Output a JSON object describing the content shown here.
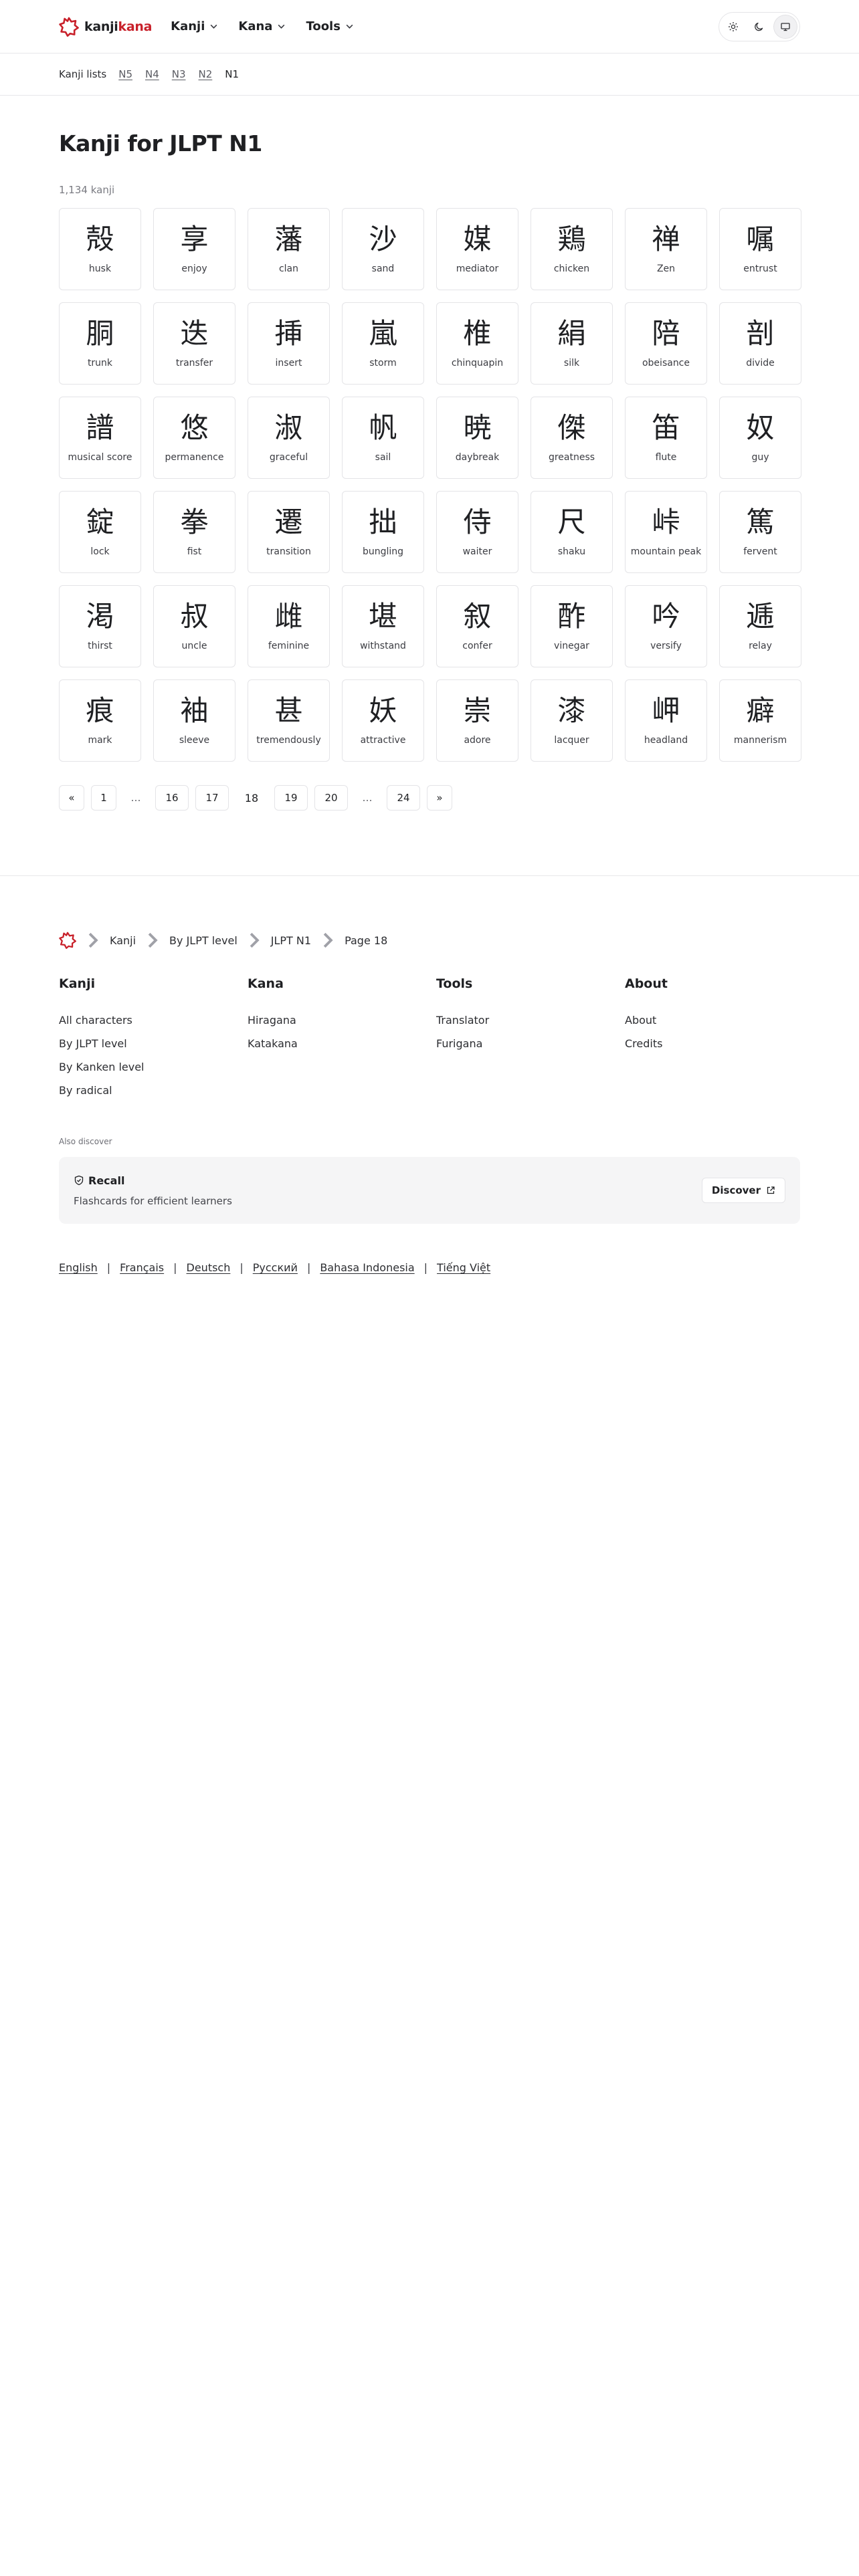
{
  "header": {
    "logo_kanji": "kanji",
    "logo_kana": "kana",
    "nav": [
      {
        "label": "Kanji"
      },
      {
        "label": "Kana"
      },
      {
        "label": "Tools"
      }
    ],
    "theme_icons": [
      "sun-icon",
      "moon-icon",
      "monitor-icon"
    ],
    "active_theme": "monitor"
  },
  "subnav": {
    "label": "Kanji lists",
    "links": [
      "N5",
      "N4",
      "N3",
      "N2"
    ],
    "current": "N1"
  },
  "main": {
    "title": "Kanji for JLPT N1",
    "count": "1,134 kanji",
    "kanji": [
      {
        "char": "殻",
        "meaning": "husk"
      },
      {
        "char": "享",
        "meaning": "enjoy"
      },
      {
        "char": "藩",
        "meaning": "clan"
      },
      {
        "char": "沙",
        "meaning": "sand"
      },
      {
        "char": "媒",
        "meaning": "mediator"
      },
      {
        "char": "鶏",
        "meaning": "chicken"
      },
      {
        "char": "禅",
        "meaning": "Zen"
      },
      {
        "char": "嘱",
        "meaning": "entrust"
      },
      {
        "char": "胴",
        "meaning": "trunk"
      },
      {
        "char": "迭",
        "meaning": "transfer"
      },
      {
        "char": "挿",
        "meaning": "insert"
      },
      {
        "char": "嵐",
        "meaning": "storm"
      },
      {
        "char": "椎",
        "meaning": "chinquapin"
      },
      {
        "char": "絹",
        "meaning": "silk"
      },
      {
        "char": "陪",
        "meaning": "obeisance"
      },
      {
        "char": "剖",
        "meaning": "divide"
      },
      {
        "char": "譜",
        "meaning": "musical score"
      },
      {
        "char": "悠",
        "meaning": "permanence"
      },
      {
        "char": "淑",
        "meaning": "graceful"
      },
      {
        "char": "帆",
        "meaning": "sail"
      },
      {
        "char": "暁",
        "meaning": "daybreak"
      },
      {
        "char": "傑",
        "meaning": "greatness"
      },
      {
        "char": "笛",
        "meaning": "flute"
      },
      {
        "char": "奴",
        "meaning": "guy"
      },
      {
        "char": "錠",
        "meaning": "lock"
      },
      {
        "char": "拳",
        "meaning": "fist"
      },
      {
        "char": "遷",
        "meaning": "transition"
      },
      {
        "char": "拙",
        "meaning": "bungling"
      },
      {
        "char": "侍",
        "meaning": "waiter"
      },
      {
        "char": "尺",
        "meaning": "shaku"
      },
      {
        "char": "峠",
        "meaning": "mountain peak"
      },
      {
        "char": "篤",
        "meaning": "fervent"
      },
      {
        "char": "渇",
        "meaning": "thirst"
      },
      {
        "char": "叔",
        "meaning": "uncle"
      },
      {
        "char": "雌",
        "meaning": "feminine"
      },
      {
        "char": "堪",
        "meaning": "withstand"
      },
      {
        "char": "叙",
        "meaning": "confer"
      },
      {
        "char": "酢",
        "meaning": "vinegar"
      },
      {
        "char": "吟",
        "meaning": "versify"
      },
      {
        "char": "逓",
        "meaning": "relay"
      },
      {
        "char": "痕",
        "meaning": "mark"
      },
      {
        "char": "袖",
        "meaning": "sleeve"
      },
      {
        "char": "甚",
        "meaning": "tremendously"
      },
      {
        "char": "妖",
        "meaning": "attractive"
      },
      {
        "char": "崇",
        "meaning": "adore"
      },
      {
        "char": "漆",
        "meaning": "lacquer"
      },
      {
        "char": "岬",
        "meaning": "headland"
      },
      {
        "char": "癖",
        "meaning": "mannerism"
      }
    ]
  },
  "pagination": {
    "prev": "«",
    "first": "1",
    "ellipsis": "…",
    "before": [
      "16",
      "17"
    ],
    "current": "18",
    "after": [
      "19",
      "20"
    ],
    "last": "24",
    "next": "»"
  },
  "footer": {
    "breadcrumb": [
      "Kanji",
      "By JLPT level",
      "JLPT N1",
      "Page 18"
    ],
    "columns": [
      {
        "title": "Kanji",
        "links": [
          "All characters",
          "By JLPT level",
          "By Kanken level",
          "By radical"
        ]
      },
      {
        "title": "Kana",
        "links": [
          "Hiragana",
          "Katakana"
        ]
      },
      {
        "title": "Tools",
        "links": [
          "Translator",
          "Furigana"
        ]
      },
      {
        "title": "About",
        "links": [
          "About",
          "Credits"
        ]
      }
    ],
    "also_discover": "Also discover",
    "recall": {
      "title": "Recall",
      "subtitle": "Flashcards for efficient learners",
      "button": "Discover"
    },
    "languages": [
      "English",
      "Français",
      "Deutsch",
      "Русский",
      "Bahasa Indonesia",
      "Tiếng Việt"
    ]
  },
  "colors": {
    "brand_red": "#c8202a",
    "text": "#1f2023",
    "border": "#e4e4e7"
  }
}
